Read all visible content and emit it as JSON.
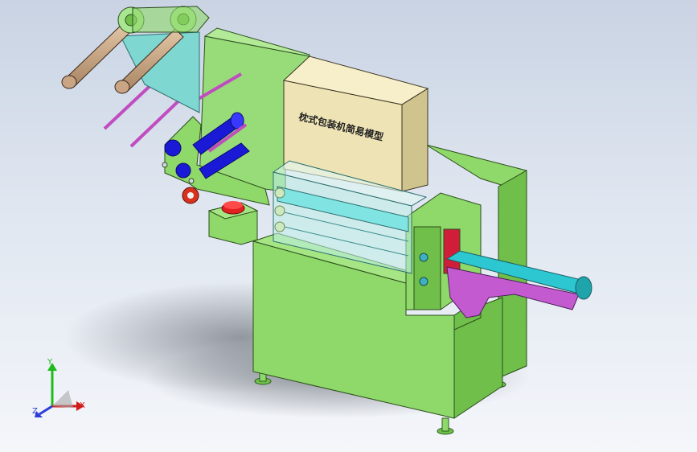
{
  "viewport": {
    "background_top": "#c9d3e3",
    "background_bottom": "#f4f6fa"
  },
  "model": {
    "label": "枕式包装机简易模型",
    "colors": {
      "frame_green": "#8fd86a",
      "frame_dark": "#6fbf4a",
      "frame_shadow": "#4f9a34",
      "cover_tan": "#ede3b4",
      "glass_cyan": "#7fe4e2",
      "rod_purple": "#c04cc0",
      "roller_blue": "#1a1ad6",
      "chute_magenta": "#c45ad0",
      "belt_cyan": "#2cc7d0",
      "emergency_red": "#e32020"
    }
  },
  "triad": {
    "x_label": "X",
    "y_label": "Y",
    "z_label": "Z",
    "x_color": "#d21c1c",
    "y_color": "#1dbb1d",
    "z_color": "#2d3ed8"
  }
}
